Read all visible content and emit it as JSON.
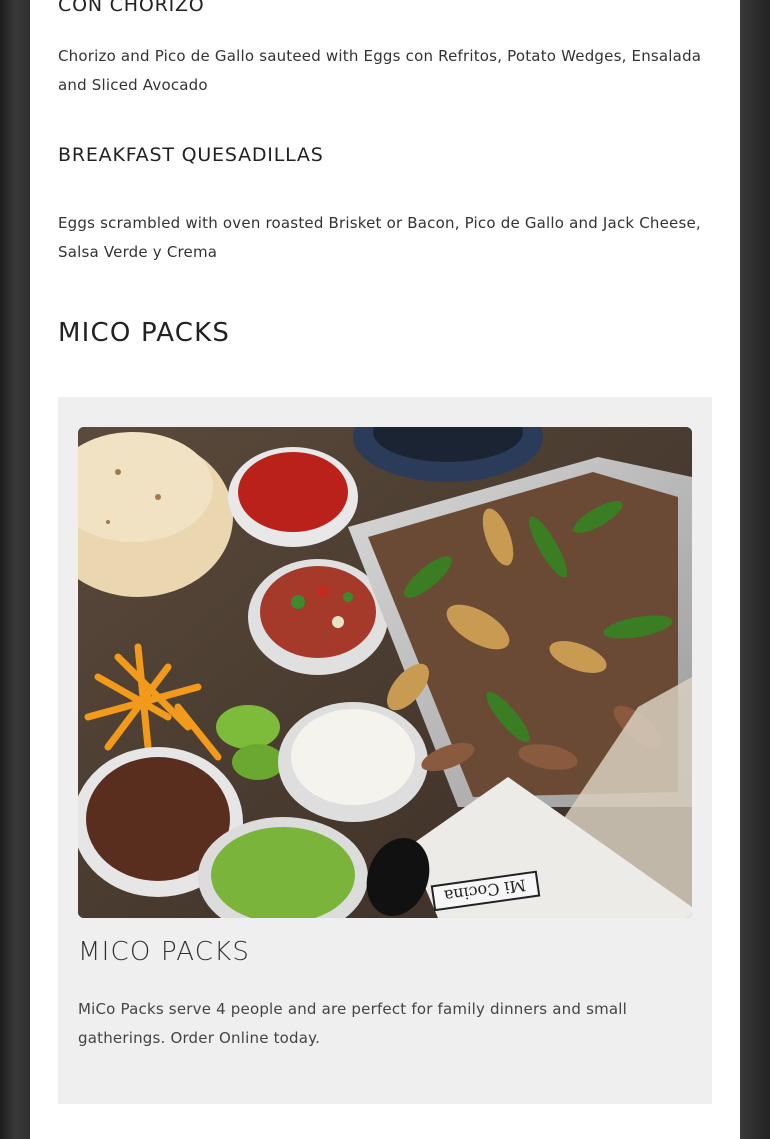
{
  "menu": {
    "items": [
      {
        "title": "CON CHORIZO",
        "description": "Chorizo and Pico de Gallo sauteed with Eggs con Refritos, Potato Wedges, Ensalada and Sliced Avocado"
      },
      {
        "title": "BREAKFAST QUESADILLAS",
        "description": "Eggs scrambled with oven roasted Brisket or Bacon, Pico de Gallo and Jack Cheese, Salsa Verde y Crema"
      }
    ]
  },
  "section": {
    "title": "MICO PACKS"
  },
  "card": {
    "image_label": "Mi Cocina",
    "title": "MICO PACKS",
    "description": "MiCo Packs serve 4 people and are perfect for family dinners and small gatherings. Order Online today."
  },
  "colors": {
    "background": "#2b2b2b",
    "panel": "#ffffff",
    "card": "#efefef",
    "text": "#222222"
  }
}
